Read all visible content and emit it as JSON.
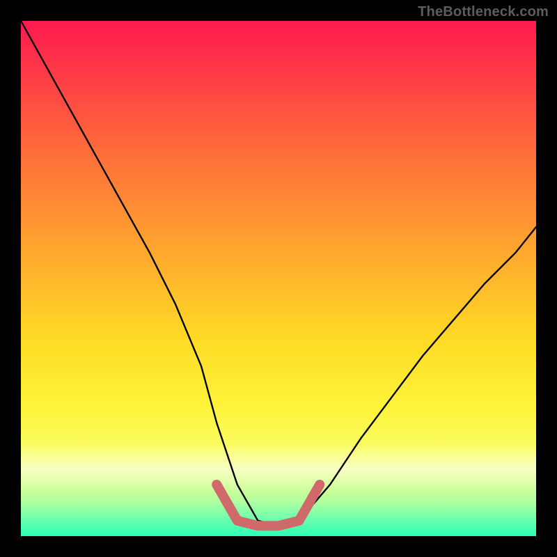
{
  "watermark": "TheBottleneck.com",
  "chart_data": {
    "type": "line",
    "title": "",
    "xlabel": "",
    "ylabel": "",
    "xlim": [
      0,
      100
    ],
    "ylim": [
      0,
      100
    ],
    "grid": false,
    "legend": false,
    "series": [
      {
        "name": "bottleneck-curve",
        "color": "#000000",
        "x": [
          0,
          5,
          10,
          15,
          20,
          25,
          30,
          35,
          38,
          42,
          46,
          50,
          54,
          60,
          66,
          72,
          78,
          84,
          90,
          96,
          100
        ],
        "y": [
          100,
          91,
          82,
          73,
          64,
          55,
          45,
          33,
          22,
          10,
          3,
          2,
          3,
          10,
          19,
          27,
          35,
          42,
          49,
          55,
          60
        ]
      },
      {
        "name": "sweet-spot-marker",
        "color": "#d06a6a",
        "x": [
          38,
          42,
          46,
          50,
          54,
          58
        ],
        "y": [
          10,
          3,
          2,
          2,
          3,
          10
        ]
      }
    ],
    "annotations": []
  },
  "colors": {
    "gradient_top": "#ff1a4f",
    "gradient_mid": "#ffdb25",
    "gradient_bottom": "#2cffb7",
    "curve": "#000000",
    "marker": "#d06a6a",
    "frame": "#000000"
  }
}
